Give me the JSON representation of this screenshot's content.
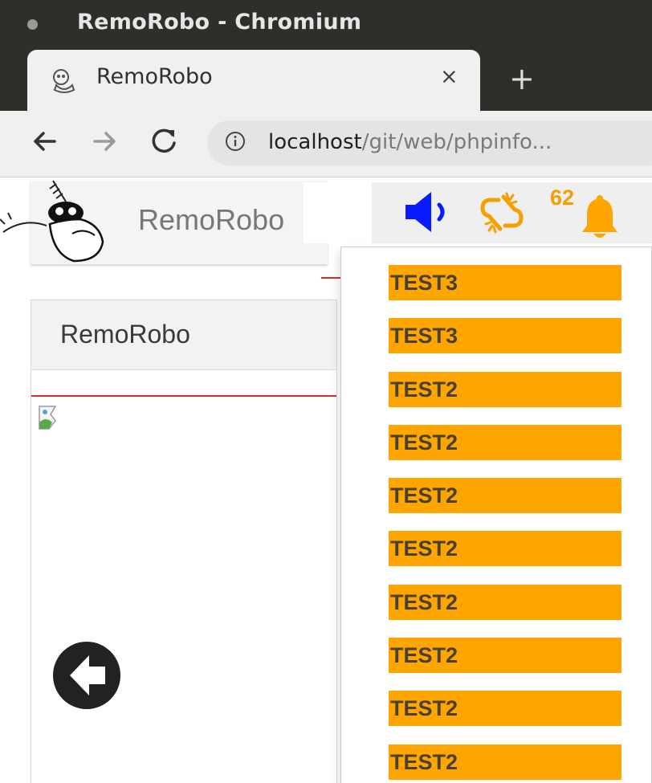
{
  "window": {
    "title": "RemoRobo - Chromium"
  },
  "tab": {
    "title": "RemoRobo",
    "close_glyph": "×",
    "new_tab_glyph": "+"
  },
  "toolbar": {
    "url_host": "localhost",
    "url_path": "/git/web/phpinfo...",
    "icons": [
      "back-arrow-icon",
      "forward-arrow-icon",
      "reload-icon",
      "info-icon"
    ]
  },
  "navbar": {
    "brand": "RemoRobo",
    "notification_count": "62",
    "icons": [
      "speaker-icon",
      "broken-link-icon",
      "bell-icon"
    ]
  },
  "panel": {
    "title": "RemoRobo"
  },
  "notifications": [
    {
      "label": "TEST3"
    },
    {
      "label": "TEST3"
    },
    {
      "label": "TEST2"
    },
    {
      "label": "TEST2"
    },
    {
      "label": "TEST2"
    },
    {
      "label": "TEST2"
    },
    {
      "label": "TEST2"
    },
    {
      "label": "TEST2"
    },
    {
      "label": "TEST2"
    },
    {
      "label": "TEST2"
    }
  ],
  "colors": {
    "notification_bg": "#ffa500",
    "accent_red": "#d32f2f",
    "speaker_blue": "#0a1aff",
    "alert_orange": "#f5a000"
  }
}
